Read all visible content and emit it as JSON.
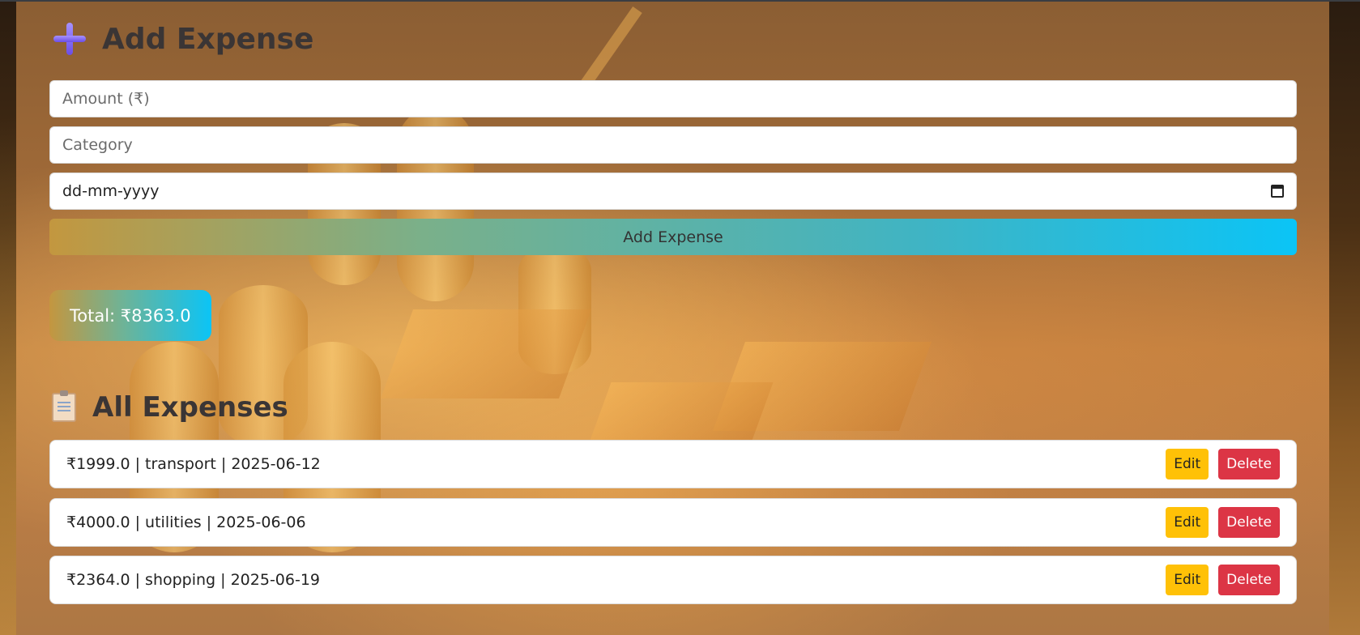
{
  "add_expense": {
    "title": "Add Expense",
    "amount_placeholder": "Amount (₹)",
    "category_placeholder": "Category",
    "date_placeholder": "dd-mm-yyyy",
    "submit_label": "Add Expense"
  },
  "summary": {
    "total_label": "Total: ₹8363.0"
  },
  "list": {
    "title": "All Expenses",
    "items": [
      {
        "text": "₹1999.0 | transport | 2025-06-12",
        "edit": "Edit",
        "delete": "Delete"
      },
      {
        "text": "₹4000.0 | utilities | 2025-06-06",
        "edit": "Edit",
        "delete": "Delete"
      },
      {
        "text": "₹2364.0 | shopping | 2025-06-19",
        "edit": "Edit",
        "delete": "Delete"
      }
    ]
  },
  "icons": {
    "add_title": "plus-icon",
    "list_title": "clipboard-icon",
    "date": "calendar-icon"
  },
  "colors": {
    "edit_button": "#ffc107",
    "delete_button": "#dc3545",
    "gradient_start": "#c4963f",
    "gradient_end": "#0bc4f6"
  }
}
